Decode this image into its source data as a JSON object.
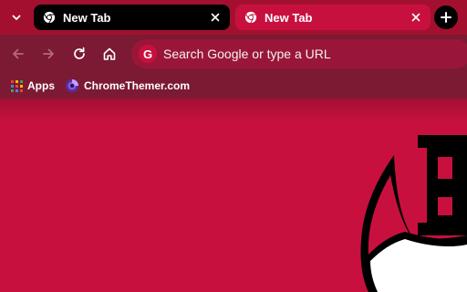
{
  "colors": {
    "tabstrip_bg": "#a3102f",
    "active_tab_bg": "#c8103e",
    "inactive_tab_bg": "#000000",
    "toolbar_bg": "#7b1a32",
    "omnibox_bg": "#9a1638",
    "content_bg": "#c8103e",
    "text": "#ffffff"
  },
  "tabstrip": {
    "tab_search_icon": "chevron-down-icon",
    "tabs": [
      {
        "title": "New Tab",
        "state": "inactive",
        "favicon": "chrome-icon"
      },
      {
        "title": "New Tab",
        "state": "active",
        "favicon": "chrome-icon"
      }
    ],
    "new_tab_icon": "plus-icon"
  },
  "toolbar": {
    "back_icon": "arrow-left-icon",
    "forward_icon": "arrow-right-icon",
    "reload_icon": "reload-icon",
    "home_icon": "home-icon",
    "omnibox": {
      "engine_icon": "google-g-icon",
      "engine_letter": "G",
      "placeholder": "Search Google or type a URL"
    }
  },
  "bookmarks": [
    {
      "label": "Apps",
      "icon": "apps-grid-icon"
    },
    {
      "label": "ChromeThemer.com",
      "icon": "chromethemer-icon"
    }
  ],
  "content": {
    "background_art": "theme-mascot-letter-B"
  }
}
